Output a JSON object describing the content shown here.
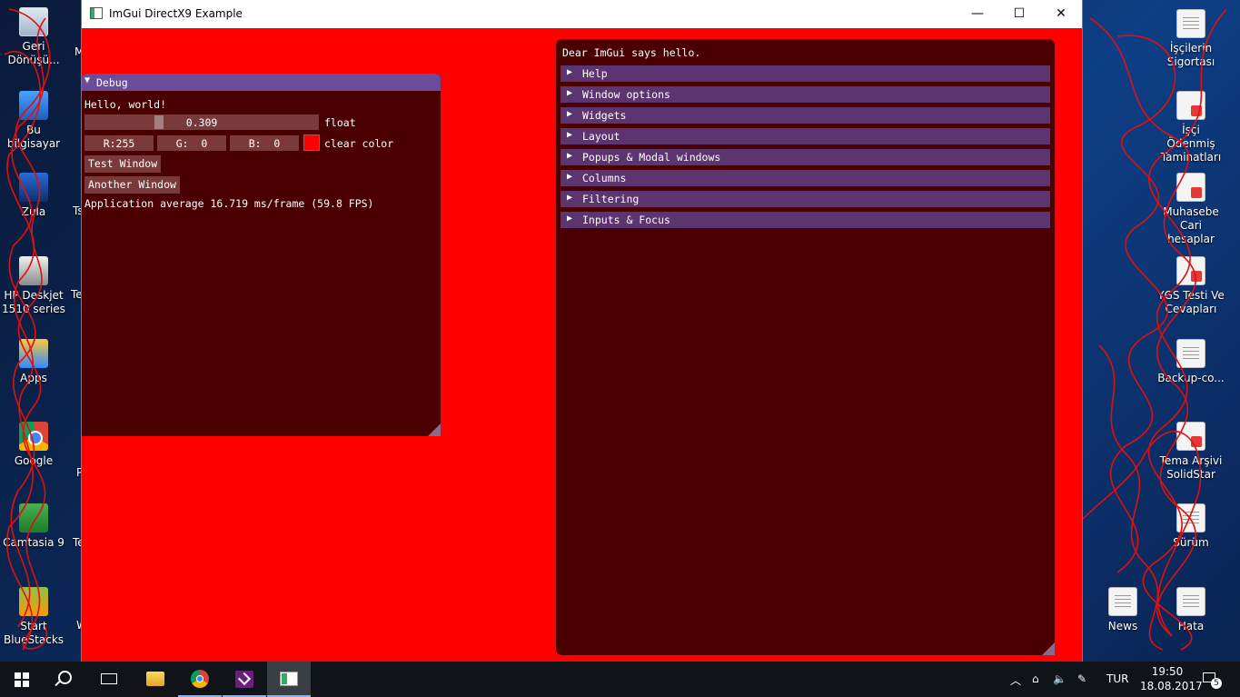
{
  "desktop": {
    "left_icons": [
      {
        "label": "Geri Dönüşü...",
        "icon": "recycle-bin-icon"
      },
      {
        "label": "Bu bilgisayar",
        "icon": "this-pc-icon"
      },
      {
        "label": "Zula",
        "icon": "zula-icon"
      },
      {
        "label": "HP Deskjet 1510 series",
        "icon": "printer-icon"
      },
      {
        "label": "Apps",
        "icon": "apps-icon"
      },
      {
        "label": "Google",
        "icon": "chrome-icon"
      },
      {
        "label": "Camtasia 9",
        "icon": "camtasia-icon"
      },
      {
        "label": "Start BlueStacks",
        "icon": "bluestacks-icon"
      }
    ],
    "partial_labels": [
      "M",
      "Ts",
      "Te",
      "P",
      "Te",
      "W"
    ],
    "right_icons": [
      {
        "label": "İşçilerin Sigortası",
        "icon": "document-icon"
      },
      {
        "label": "İşçi Ödenmiş Taminatları",
        "icon": "pdf-icon"
      },
      {
        "label": "Muhasebe Cari hesaplar",
        "icon": "pdf-icon"
      },
      {
        "label": "YGS Testi Ve Cevapları",
        "icon": "pdf-icon"
      },
      {
        "label": "Backup-co...",
        "icon": "document-icon"
      },
      {
        "label": "Tema Arşivi SolidStar",
        "icon": "pdf-icon"
      },
      {
        "label": "Sürüm",
        "icon": "document-icon"
      },
      {
        "label": "News",
        "icon": "document-icon"
      },
      {
        "label": "Hata",
        "icon": "document-icon"
      }
    ]
  },
  "window": {
    "title": "ImGui DirectX9 Example",
    "minimize": "—",
    "maximize": "☐",
    "close": "✕"
  },
  "debug": {
    "title": "Debug",
    "hello": "Hello, world!",
    "slider_value": "0.309",
    "slider_fraction": 0.309,
    "slider_label": "float",
    "r": "R:255",
    "g": "G:  0",
    "b": "B:  0",
    "clear_color": "#ff0000",
    "clear_color_label": "clear color",
    "test_window_button": "Test Window",
    "another_window_button": "Another Window",
    "fps_text": "Application average 16.719 ms/frame (59.8 FPS)"
  },
  "demo": {
    "greeting": "Dear ImGui says hello.",
    "headers": [
      "Help",
      "Window options",
      "Widgets",
      "Layout",
      "Popups & Modal windows",
      "Columns",
      "Filtering",
      "Inputs & Focus"
    ]
  },
  "taskbar": {
    "language": "TUR",
    "time": "19:50",
    "date": "18.08.2017",
    "notifications": "5"
  },
  "colors": {
    "app_background": "#ff0000",
    "imgui_window_bg": "#4a0000",
    "title_active": "#6b4c9a",
    "header": "#5c3470",
    "widget_frame": "#7a3a3a"
  }
}
